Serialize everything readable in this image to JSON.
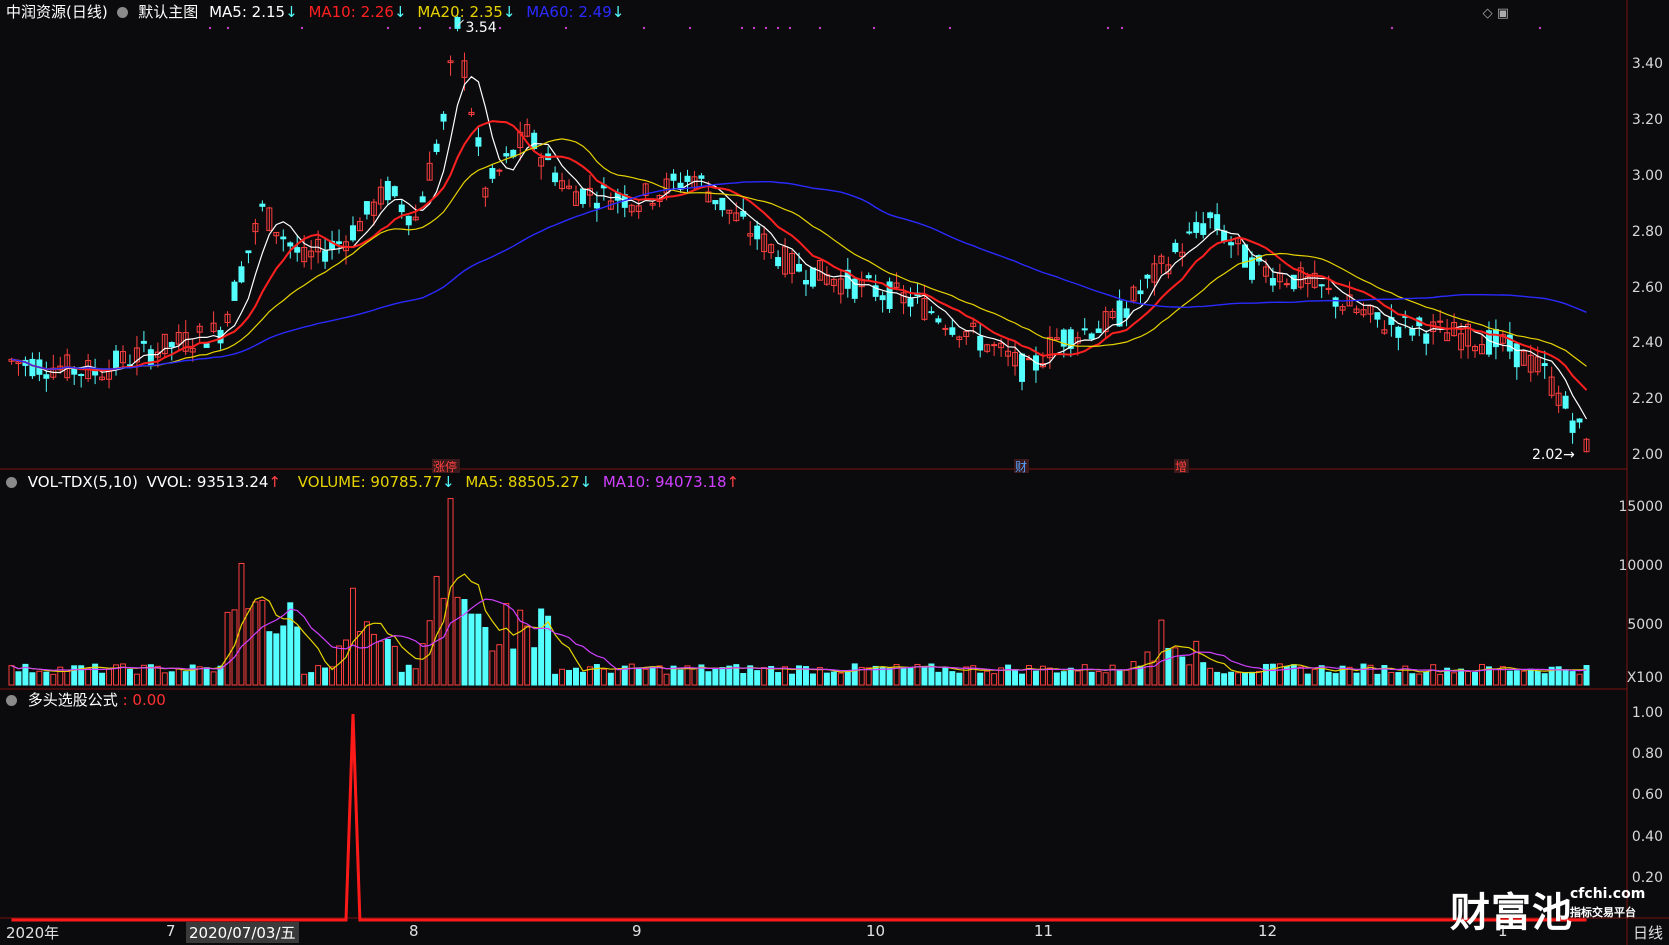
{
  "main_panel": {
    "title": "中润资源(日线)",
    "template": "默认主图",
    "ma5": {
      "label": "MA5:",
      "value": "2.15",
      "arrow": "↓",
      "color": "#ffffff"
    },
    "ma10": {
      "label": "MA10:",
      "value": "2.26",
      "arrow": "↓",
      "color": "#ff2020"
    },
    "ma20": {
      "label": "MA20:",
      "value": "2.35",
      "arrow": "↓",
      "color": "#e6d200"
    },
    "ma60": {
      "label": "MA60:",
      "value": "2.49",
      "arrow": "↓",
      "color": "#2a2aff"
    },
    "high_marker": "3.54",
    "low_marker": "2.02",
    "y_ticks": [
      "3.40",
      "3.20",
      "3.00",
      "2.80",
      "2.60",
      "2.40",
      "2.20",
      "2.00"
    ],
    "events": [
      "涨停",
      "财",
      "增"
    ]
  },
  "volume_panel": {
    "title": "VOL-TDX(5,10)",
    "vvol": "VVOL: 93513.24",
    "vvol_arrow": "↑",
    "volume": "VOLUME: 90785.77",
    "volume_arrow": "↓",
    "ma5": "MA5: 88505.27",
    "ma5_arrow": "↓",
    "ma10": "MA10: 94073.18",
    "ma10_arrow": "↑",
    "y_ticks": [
      "15000",
      "10000",
      "5000"
    ],
    "unit": "X100"
  },
  "indicator_panel": {
    "title": "多头选股公式",
    "value": ": 0.00",
    "y_ticks": [
      "1.00",
      "0.80",
      "0.60",
      "0.40",
      "0.20"
    ]
  },
  "x_axis": {
    "labels": [
      "2020年",
      "7",
      "2020/07/03/五",
      "8",
      "9",
      "10",
      "11",
      "12",
      "1"
    ],
    "period": "日线"
  },
  "watermark": {
    "brand": "财富池",
    "site": "cfchi.com",
    "slogan": "指标交易平台"
  },
  "colors": {
    "up": "#ff4040",
    "down": "#54ffff",
    "bg": "#0b0b0d"
  }
}
